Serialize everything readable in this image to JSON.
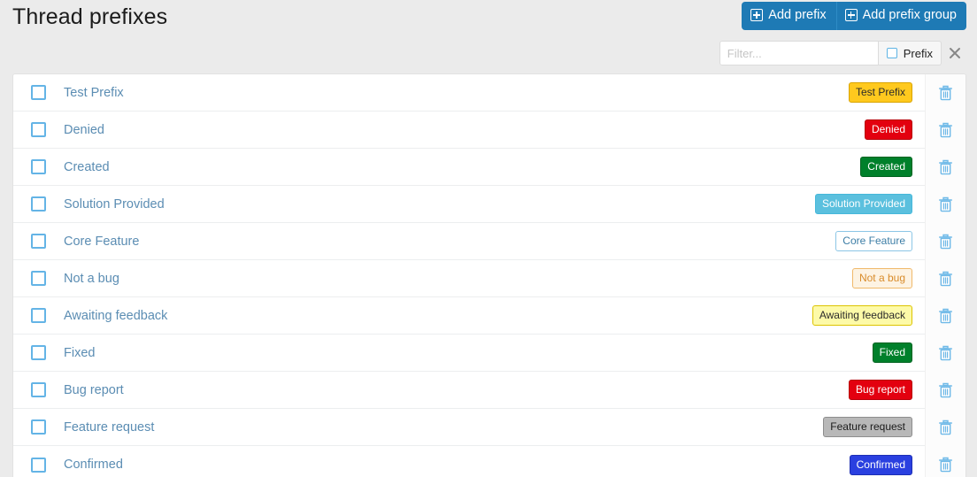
{
  "header": {
    "title": "Thread prefixes",
    "buttons": [
      {
        "label": "Add prefix",
        "icon": "plus-square-icon"
      },
      {
        "label": "Add prefix group",
        "icon": "plus-square-icon"
      }
    ],
    "accent_color": "#1e7ab5"
  },
  "filter": {
    "placeholder": "Filter...",
    "value": "",
    "toggle_label": "Prefix",
    "toggle_checked": false,
    "close_icon": "close-icon"
  },
  "list": {
    "delete_icon": "trash-icon",
    "checkbox_icon": "checkbox-unchecked-icon",
    "rows": [
      {
        "title": "Test Prefix",
        "badge": "Test Prefix",
        "badge_bg": "#ffc91e",
        "badge_fg": "#2b2b2b",
        "badge_border": "#d9a400"
      },
      {
        "title": "Denied",
        "badge": "Denied",
        "badge_bg": "#e3000f",
        "badge_fg": "#ffffff",
        "badge_border": "#b70009"
      },
      {
        "title": "Created",
        "badge": "Created",
        "badge_bg": "#00802b",
        "badge_fg": "#ffffff",
        "badge_border": "#006320"
      },
      {
        "title": "Solution Provided",
        "badge": "Solution Provided",
        "badge_bg": "#5bc0de",
        "badge_fg": "#ffffff",
        "badge_border": "#46b8da"
      },
      {
        "title": "Core Feature",
        "badge": "Core Feature",
        "badge_bg": "#ffffff",
        "badge_fg": "#3d7ea6",
        "badge_border": "#8cc6e6"
      },
      {
        "title": "Not a bug",
        "badge": "Not a bug",
        "badge_bg": "#fdf3e3",
        "badge_fg": "#d98c2b",
        "badge_border": "#f0b96a"
      },
      {
        "title": "Awaiting feedback",
        "badge": "Awaiting feedback",
        "badge_bg": "#fdfaa8",
        "badge_fg": "#2b2b2b",
        "badge_border": "#ddc400"
      },
      {
        "title": "Fixed",
        "badge": "Fixed",
        "badge_bg": "#00802b",
        "badge_fg": "#ffffff",
        "badge_border": "#006320"
      },
      {
        "title": "Bug report",
        "badge": "Bug report",
        "badge_bg": "#e3000f",
        "badge_fg": "#ffffff",
        "badge_border": "#b70009"
      },
      {
        "title": "Feature request",
        "badge": "Feature request",
        "badge_bg": "#b8b8b8",
        "badge_fg": "#1b1b1b",
        "badge_border": "#8d8d8d"
      },
      {
        "title": "Confirmed",
        "badge": "Confirmed",
        "badge_bg": "#2a40e0",
        "badge_fg": "#ffffff",
        "badge_border": "#1d2fb5"
      }
    ]
  }
}
